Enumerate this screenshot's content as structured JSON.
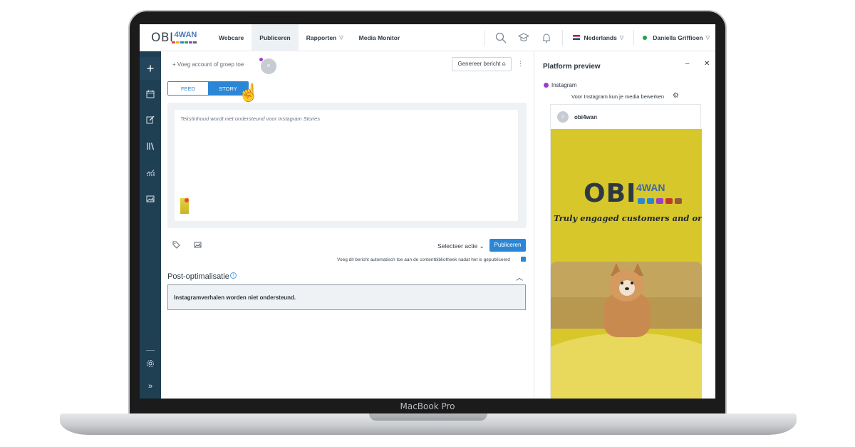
{
  "device": {
    "label": "MacBook Pro"
  },
  "logo": {
    "main": "OBI",
    "accent": "4WAN",
    "dot_colors": [
      "#e14a4a",
      "#f0a92a",
      "#2b86d6",
      "#1fa44a",
      "#9b3ec8",
      "#5b6670"
    ]
  },
  "nav": {
    "items": [
      {
        "label": "Webcare",
        "active": false,
        "has_caret": false
      },
      {
        "label": "Publiceren",
        "active": true,
        "has_caret": false
      },
      {
        "label": "Rapporten",
        "active": false,
        "has_caret": true
      },
      {
        "label": "Media Monitor",
        "active": false,
        "has_caret": false
      }
    ],
    "icons": [
      "search-icon",
      "graduation-cap-icon",
      "bell-icon"
    ],
    "language": "Nederlands",
    "user": "Daniella Griffioen",
    "status_color": "#1fa44a"
  },
  "sidebar": {
    "icons": [
      "plus-icon",
      "calendar-icon",
      "edit-icon",
      "library-icon",
      "chart-icon",
      "image-icon",
      "gear-icon",
      "expand-icon"
    ]
  },
  "editor": {
    "add_account": "+ Voeg account of groep toe",
    "account_initial": "o",
    "generate_button": "Genereer bericht",
    "toggle": {
      "feed": "FEED",
      "story": "STORY",
      "selected": "STORY"
    },
    "placeholder": "Tekstinhoud wordt niet ondersteund voor Instagram Stories",
    "select_action": "Selecteer actie",
    "publish_button": "Publiceren",
    "auto_note": "Voeg dit bericht automatisch toe aan de contentbibliotheek nadat het is gepubliceerd",
    "auto_checked": true,
    "post_optimization": {
      "title": "Post-optimalisatie",
      "message": "Instagramverhalen worden niet ondersteund."
    }
  },
  "preview": {
    "title": "Platform preview",
    "platform": "Instagram",
    "note": "Voor Instagram kun je media bewerken",
    "account_initial": "o",
    "account_name": "obi4wan",
    "image": {
      "wall_logo_main": "OBI",
      "wall_logo_accent": "4WAN",
      "slogan": "Truly engaged customers and organisa"
    }
  },
  "colors": {
    "accent": "#2b86d6",
    "sidebar": "#1f3f53",
    "instagram": "#9b3ec8"
  }
}
